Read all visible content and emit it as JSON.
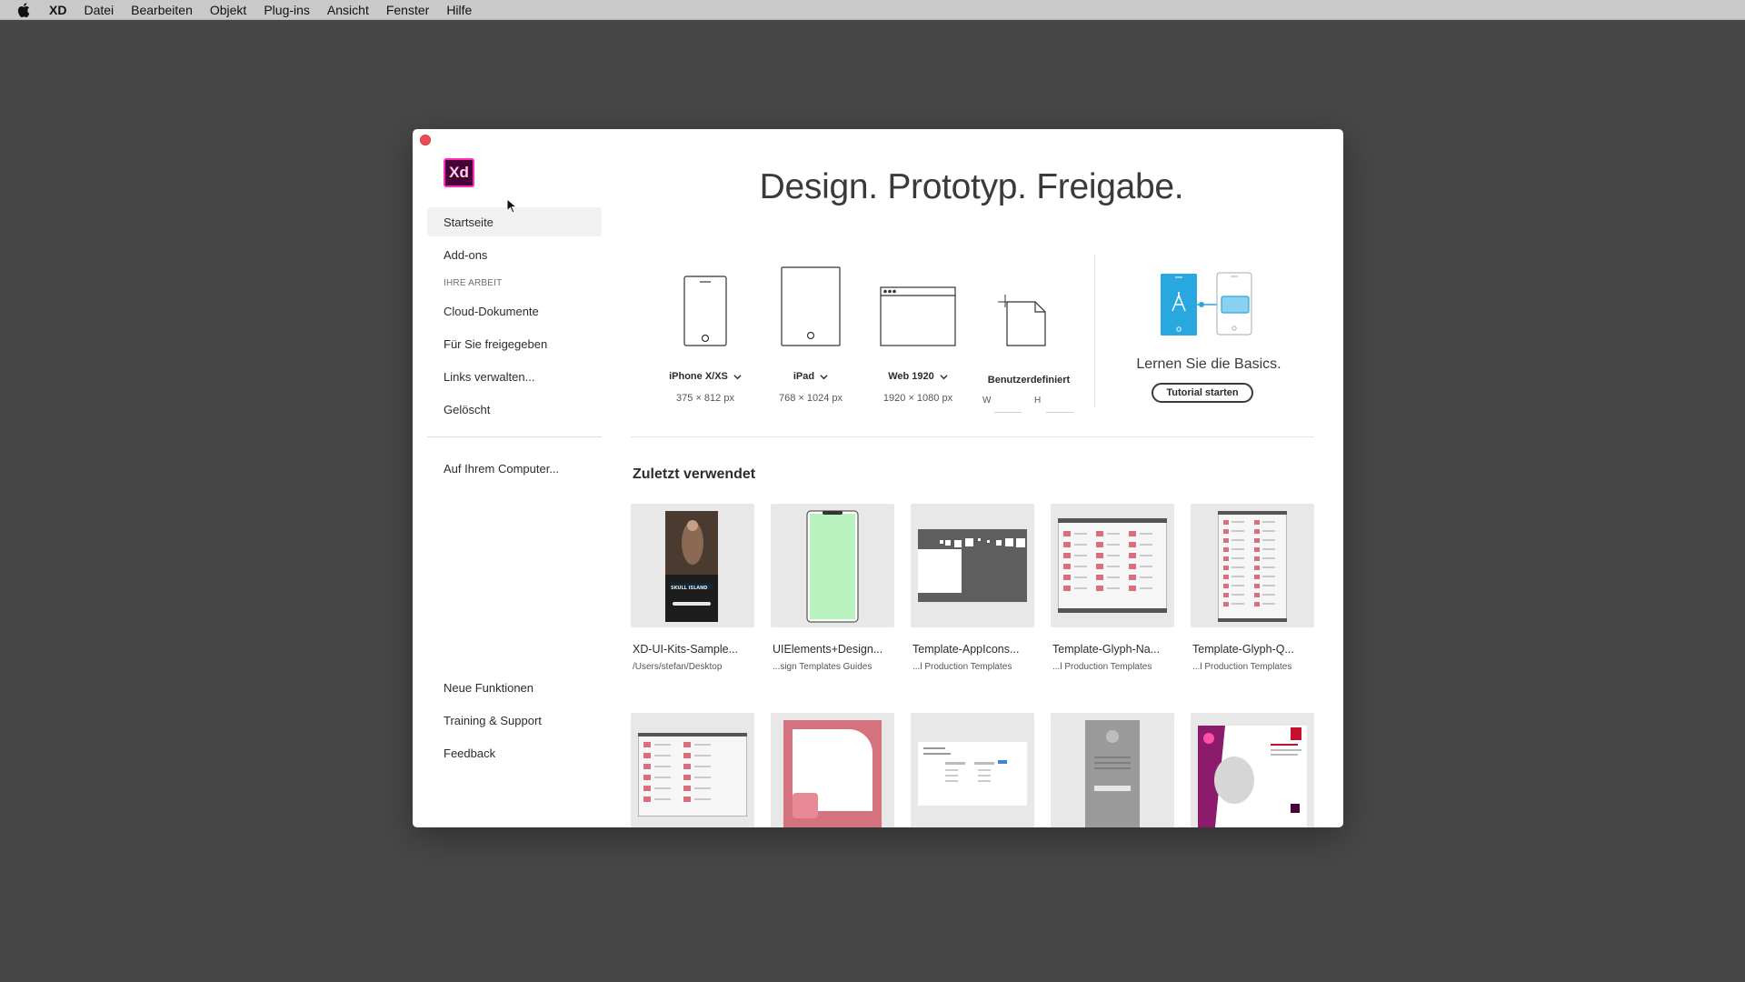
{
  "menubar": {
    "app_name": "XD",
    "items": [
      "Datei",
      "Bearbeiten",
      "Objekt",
      "Plug-ins",
      "Ansicht",
      "Fenster",
      "Hilfe"
    ]
  },
  "logo": {
    "text": "Xd"
  },
  "sidebar": {
    "items": [
      {
        "label": "Startseite",
        "active": true
      },
      {
        "label": "Add-ons"
      }
    ],
    "section_title": "IHRE ARBEIT",
    "work_items": [
      {
        "label": "Cloud-Dokumente"
      },
      {
        "label": "Für Sie freigegeben"
      },
      {
        "label": "Links verwalten..."
      },
      {
        "label": "Gelöscht"
      }
    ],
    "computer_item": "Auf Ihrem Computer...",
    "bottom_items": [
      {
        "label": "Neue Funktionen"
      },
      {
        "label": "Training & Support"
      },
      {
        "label": "Feedback"
      }
    ]
  },
  "main": {
    "headline": "Design. Prototyp. Freigabe.",
    "presets": [
      {
        "name": "iPhone X/XS",
        "size": "375 × 812 px",
        "icon": "phone-icon"
      },
      {
        "name": "iPad",
        "size": "768 × 1024 px",
        "icon": "tablet-icon"
      },
      {
        "name": "Web 1920",
        "size": "1920 × 1080 px",
        "icon": "browser-icon"
      }
    ],
    "custom": {
      "name": "Benutzerdefiniert",
      "w_label": "W",
      "h_label": "H"
    },
    "learn": {
      "text": "Lernen Sie die Basics.",
      "button": "Tutorial starten"
    },
    "recent_title": "Zuletzt verwendet",
    "recent": [
      {
        "name": "XD-UI-Kits-Sample...",
        "path": "/Users/stefan/Desktop"
      },
      {
        "name": "UIElements+Design...",
        "path": "...sign Templates Guides"
      },
      {
        "name": "Template-AppIcons...",
        "path": "...l Production Templates"
      },
      {
        "name": "Template-Glyph-Na...",
        "path": "...l Production Templates"
      },
      {
        "name": "Template-Glyph-Q...",
        "path": "...l Production Templates"
      }
    ],
    "thumb_text": {
      "skull_title": "SKULL ISLAND"
    }
  },
  "colors": {
    "accent_close": "#ec4c55",
    "xd_brand": "#ff2bc2",
    "xd_bg": "#470137",
    "tutorial_blue": "#29a8e0"
  }
}
